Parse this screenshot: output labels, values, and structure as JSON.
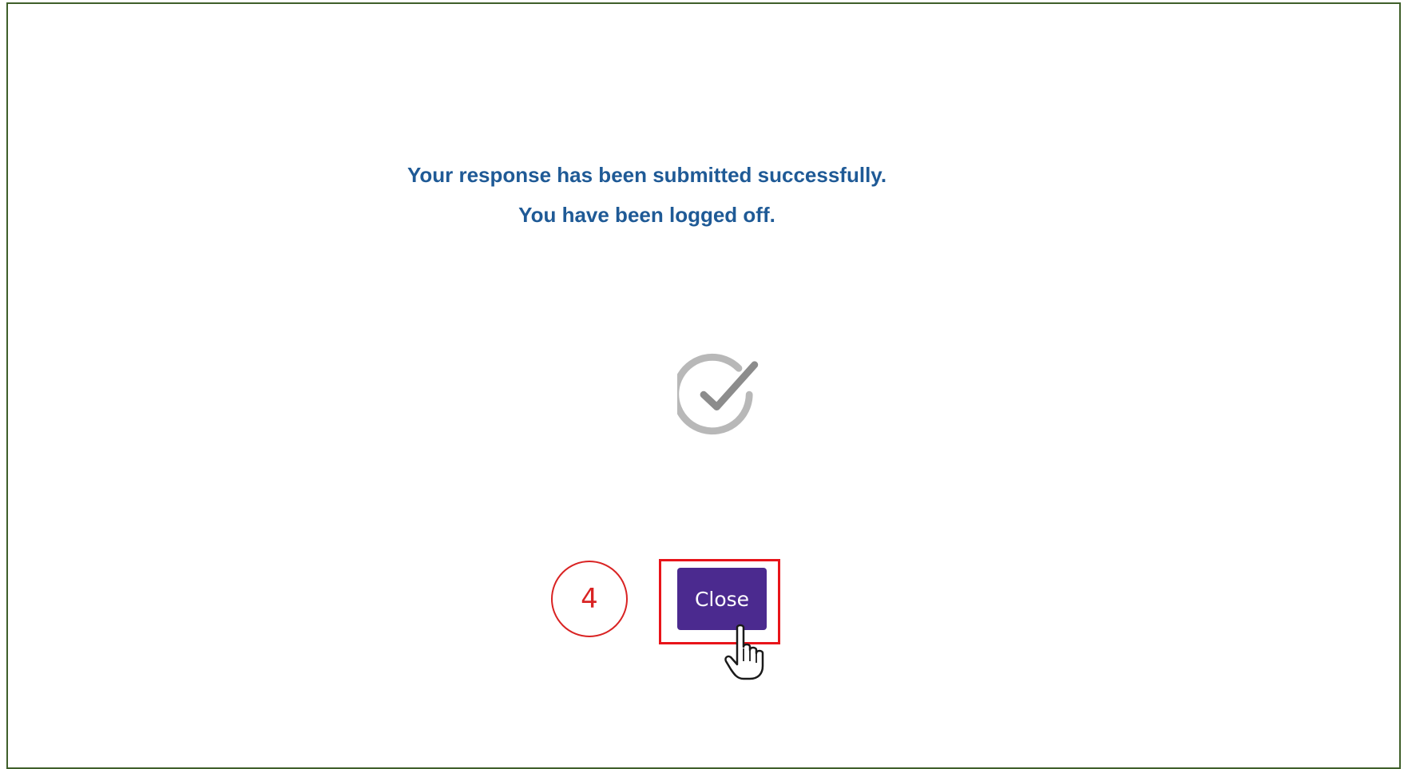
{
  "message": {
    "line1": "Your response has been submitted successfully.",
    "line2": "You have been logged off."
  },
  "icons": {
    "success": "check-circle-icon",
    "cursor": "hand-pointer-icon"
  },
  "annotation": {
    "step_number": "4"
  },
  "actions": {
    "close_label": "Close"
  },
  "colors": {
    "message_text": "#1f5a96",
    "button_bg": "#4b2a8f",
    "annotation_red": "#e8141a",
    "frame_border": "#3f5f2a",
    "icon_gray": "#9b9b9b"
  }
}
